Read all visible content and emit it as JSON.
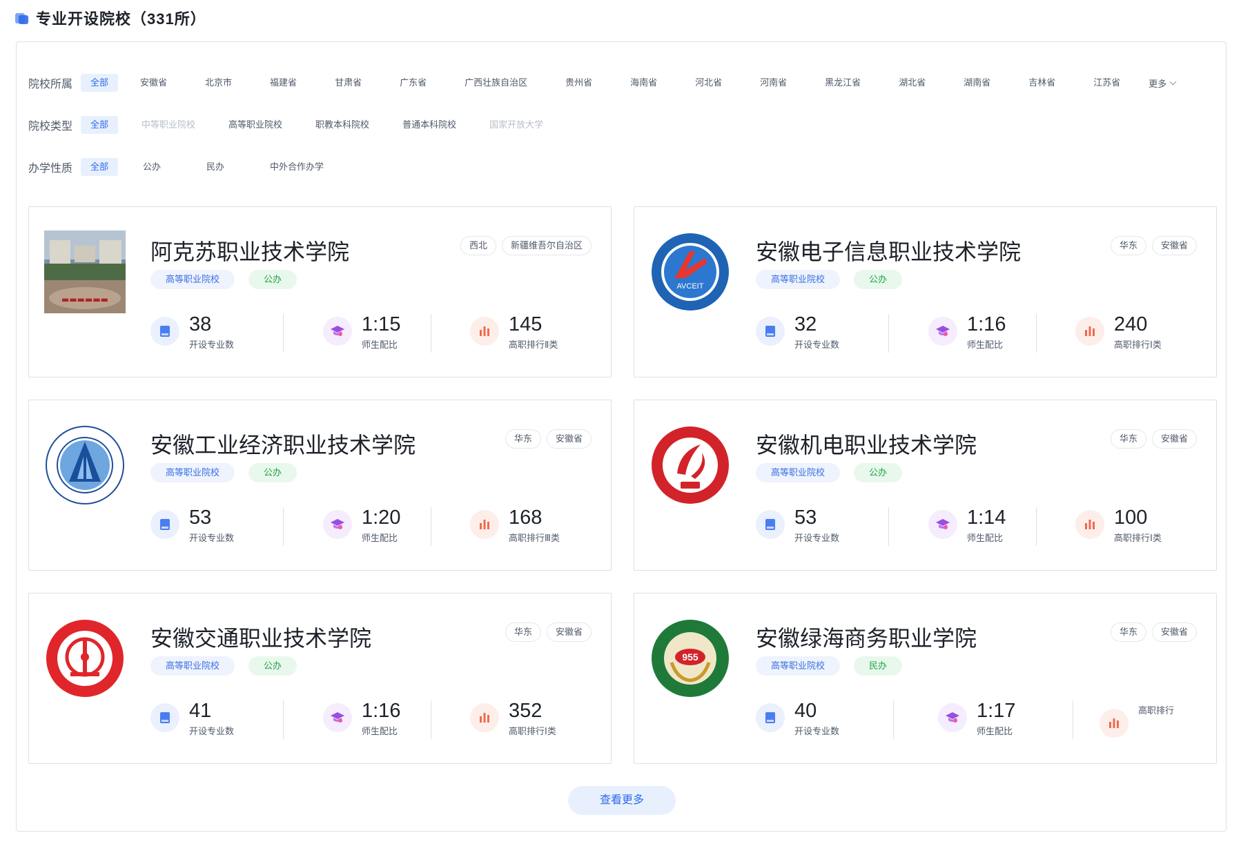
{
  "page": {
    "title": "专业开设院校（331所）"
  },
  "filters": {
    "province": {
      "label": "院校所属",
      "options": [
        "全部",
        "安徽省",
        "北京市",
        "福建省",
        "甘肃省",
        "广东省",
        "广西壮族自治区",
        "贵州省",
        "海南省",
        "河北省",
        "河南省",
        "黑龙江省",
        "湖北省",
        "湖南省",
        "吉林省",
        "江苏省"
      ],
      "selected": "全部",
      "more_label": "更多"
    },
    "school_type": {
      "label": "院校类型",
      "options": [
        "全部",
        "中等职业院校",
        "高等职业院校",
        "职教本科院校",
        "普通本科院校",
        "国家开放大学"
      ],
      "selected": "全部"
    },
    "ownership": {
      "label": "办学性质",
      "options": [
        "全部",
        "公办",
        "民办",
        "中外合作办学"
      ],
      "selected": "全部"
    }
  },
  "stat_labels": {
    "majors": "开设专业数",
    "ratio": "师生配比"
  },
  "schools": [
    {
      "name": "阿克苏职业技术学院",
      "region": "西北",
      "province": "新疆维吾尔自治区",
      "type": "高等职业院校",
      "ownership": "公办",
      "majors": "38",
      "ratio": "1:15",
      "rank": "145",
      "rank_label": "高职排行Ⅱ类"
    },
    {
      "name": "安徽电子信息职业技术学院",
      "region": "华东",
      "province": "安徽省",
      "type": "高等职业院校",
      "ownership": "公办",
      "majors": "32",
      "ratio": "1:16",
      "rank": "240",
      "rank_label": "高职排行Ⅰ类",
      "logo_text": "AVCEIT"
    },
    {
      "name": "安徽工业经济职业技术学院",
      "region": "华东",
      "province": "安徽省",
      "type": "高等职业院校",
      "ownership": "公办",
      "majors": "53",
      "ratio": "1:20",
      "rank": "168",
      "rank_label": "高职排行Ⅲ类"
    },
    {
      "name": "安徽机电职业技术学院",
      "region": "华东",
      "province": "安徽省",
      "type": "高等职业院校",
      "ownership": "公办",
      "majors": "53",
      "ratio": "1:14",
      "rank": "100",
      "rank_label": "高职排行Ⅰ类"
    },
    {
      "name": "安徽交通职业技术学院",
      "region": "华东",
      "province": "安徽省",
      "type": "高等职业院校",
      "ownership": "公办",
      "majors": "41",
      "ratio": "1:16",
      "rank": "352",
      "rank_label": "高职排行Ⅰ类"
    },
    {
      "name": "安徽绿海商务职业学院",
      "region": "华东",
      "province": "安徽省",
      "type": "高等职业院校",
      "ownership": "民办",
      "majors": "40",
      "ratio": "1:17",
      "rank": "",
      "rank_label": "高职排行",
      "logo_text": "955"
    }
  ],
  "load_more": "查看更多",
  "colors": {
    "accent": "#2f6bea",
    "green": "#22a148"
  }
}
